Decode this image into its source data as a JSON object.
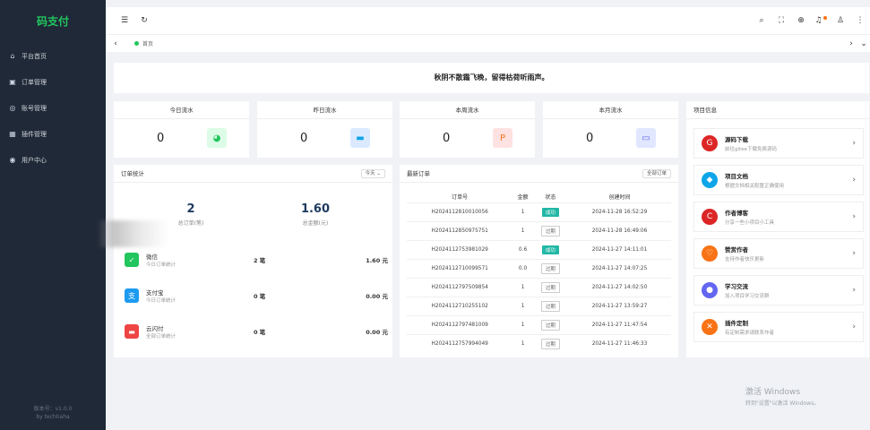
{
  "app": {
    "title": "码支付",
    "version": "版本号：v1.0.0",
    "author": "by techhaha"
  },
  "sidebar": {
    "items": [
      {
        "icon": "home-icon",
        "glyph": "⌂",
        "label": "平台首页"
      },
      {
        "icon": "order-icon",
        "glyph": "▣",
        "label": "订单管理"
      },
      {
        "icon": "account-icon",
        "glyph": "◎",
        "label": "账号管理"
      },
      {
        "icon": "plugin-icon",
        "glyph": "▦",
        "label": "插件管理"
      },
      {
        "icon": "user-icon",
        "glyph": "◉",
        "label": "用户中心"
      }
    ]
  },
  "tabs": {
    "home_label": "首页"
  },
  "notice": "秋阴不散霜飞晚，留得枯荷听雨声。",
  "stats": [
    {
      "title": "今日流水",
      "value": "0",
      "icon": "pie-chart-icon",
      "glyph": "◕",
      "color": "#22c55e",
      "bg": "#dcfce7"
    },
    {
      "title": "昨日流水",
      "value": "0",
      "icon": "wallet-icon",
      "glyph": "▬",
      "color": "#0ea5e9",
      "bg": "#dbeafe"
    },
    {
      "title": "本周流水",
      "value": "0",
      "icon": "paypal-icon",
      "glyph": "P",
      "color": "#f97316",
      "bg": "#fee2e2"
    },
    {
      "title": "本月流水",
      "value": "0",
      "icon": "card-icon",
      "glyph": "▭",
      "color": "#6366f1",
      "bg": "#e0e7ff"
    }
  ],
  "order_stats": {
    "title": "订单统计",
    "period_label": "今天",
    "total_orders": "2",
    "total_orders_label": "总订单(笔)",
    "total_amount": "1.60",
    "total_amount_label": "总金额(元)",
    "rows": [
      {
        "icon": "wechat-icon",
        "glyph": "✓",
        "color": "#22c55e",
        "name": "微信",
        "sub": "今日订单统计",
        "count": "2 笔",
        "amount": "1.60 元"
      },
      {
        "icon": "alipay-icon",
        "glyph": "支",
        "color": "#1d9bf0",
        "name": "支付宝",
        "sub": "今日订单统计",
        "count": "0 笔",
        "amount": "0.00 元"
      },
      {
        "icon": "unionpay-icon",
        "glyph": "▬",
        "color": "#ef4444",
        "name": "云闪付",
        "sub": "全部订单统计",
        "count": "0 笔",
        "amount": "0.00 元"
      }
    ]
  },
  "latest_orders": {
    "title": "最新订单",
    "all_label": "全部订单",
    "headers": [
      "订单号",
      "金额",
      "状态",
      "创建时间"
    ],
    "rows": [
      {
        "id": "H2024112810010056",
        "amount": "1",
        "status": "成功",
        "ok": true,
        "time": "2024-11-28 16:52:29"
      },
      {
        "id": "H2024112850975751",
        "amount": "1",
        "status": "过期",
        "ok": false,
        "time": "2024-11-28 16:49:06"
      },
      {
        "id": "H2024112753981029",
        "amount": "0.6",
        "status": "成功",
        "ok": true,
        "time": "2024-11-27 14:11:01"
      },
      {
        "id": "H2024112710099571",
        "amount": "0.0",
        "status": "过期",
        "ok": false,
        "time": "2024-11-27 14:07:25"
      },
      {
        "id": "H2024112797509854",
        "amount": "1",
        "status": "过期",
        "ok": false,
        "time": "2024-11-27 14:02:50"
      },
      {
        "id": "H2024112710255102",
        "amount": "1",
        "status": "过期",
        "ok": false,
        "time": "2024-11-27 13:59:27"
      },
      {
        "id": "H2024112797481009",
        "amount": "1",
        "status": "过期",
        "ok": false,
        "time": "2024-11-27 11:47:54"
      },
      {
        "id": "H2024112757994049",
        "amount": "1",
        "status": "过期",
        "ok": false,
        "time": "2024-11-27 11:46:33"
      }
    ]
  },
  "project": {
    "title": "项目信息",
    "items": [
      {
        "icon": "gitee-icon",
        "glyph": "G",
        "color": "#dc2626",
        "title": "源码下载",
        "sub": "前往gitee下载免费源码"
      },
      {
        "icon": "docs-icon",
        "glyph": "◆",
        "color": "#0ea5e9",
        "title": "项目文档",
        "sub": "根据文档相关配置正确使用"
      },
      {
        "icon": "csdn-icon",
        "glyph": "C",
        "color": "#dc2626",
        "title": "作者博客",
        "sub": "分享一些小项目小工具"
      },
      {
        "icon": "like-icon",
        "glyph": "♡",
        "color": "#f97316",
        "title": "赞赏作者",
        "sub": "支持作者快乐更新"
      },
      {
        "icon": "chat-icon",
        "glyph": "●",
        "color": "#6366f1",
        "title": "学习交流",
        "sub": "加入项目学习交流群"
      },
      {
        "icon": "tool-icon",
        "glyph": "✕",
        "color": "#f97316",
        "title": "插件定制",
        "sub": "有定制需求请联系作者"
      }
    ]
  },
  "watermark": {
    "line1": "激活 Windows",
    "line2": "转到\"设置\"以激活 Windows。"
  }
}
